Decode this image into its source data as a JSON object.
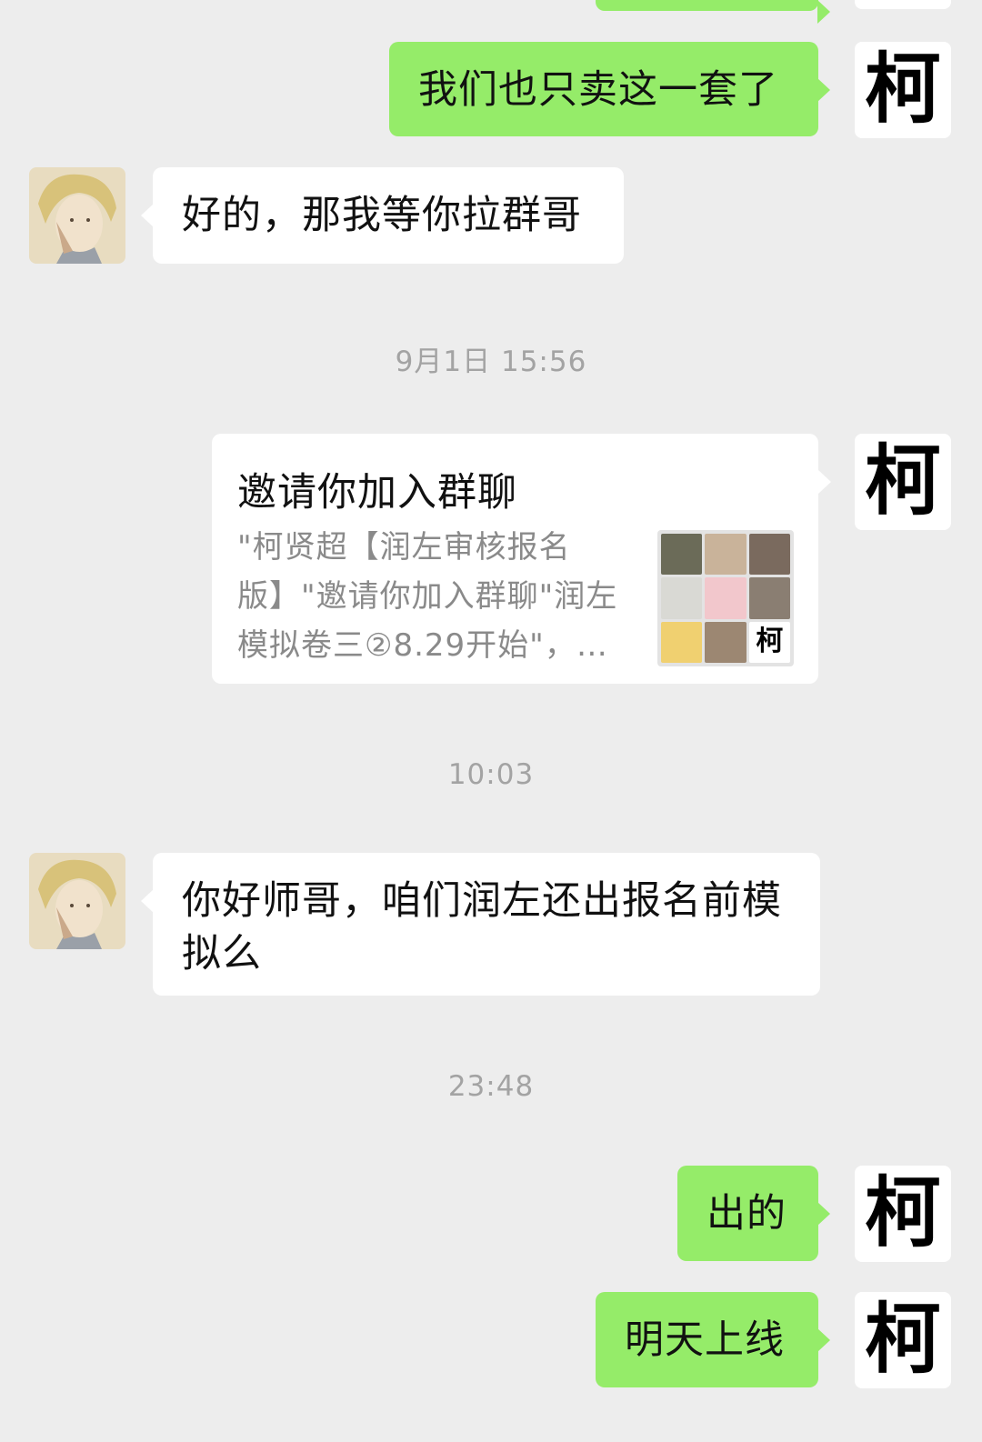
{
  "chat": {
    "msg1": "我们也只卖这一套了",
    "msg2": "好的，那我等你拉群哥",
    "ts1": "9月1日 15:56",
    "invite": {
      "title": "邀请你加入群聊",
      "desc": "\"柯贤超【润左审核报名版】\"邀请你加入群聊\"润左模拟卷三②8.29开始\"，…"
    },
    "ts2": "10:03",
    "msg3": "你好师哥，咱们润左还出报名前模拟么",
    "ts3": "23:48",
    "msg4": "出的",
    "msg5": "明天上线"
  },
  "avatar_char": "柯",
  "colors": {
    "background": "#ededed",
    "sent_bubble": "#95ec69",
    "received_bubble": "#ffffff",
    "timestamp": "#a3a3a3"
  }
}
